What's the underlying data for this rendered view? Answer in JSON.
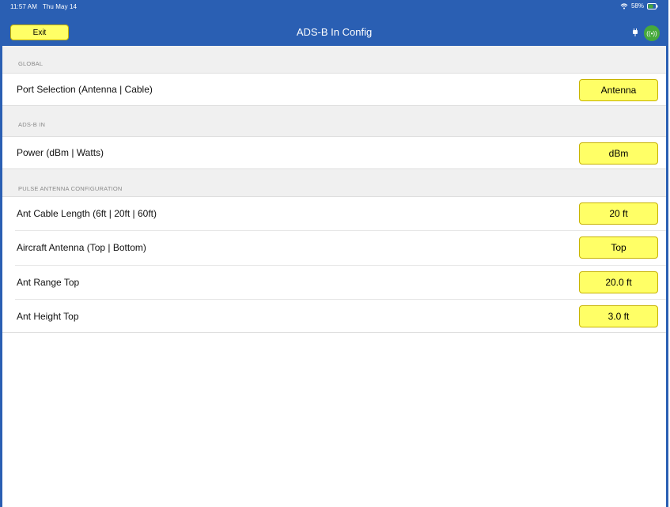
{
  "statusbar": {
    "time": "11:57 AM",
    "date": "Thu May 14",
    "battery": "58%"
  },
  "header": {
    "title": "ADS-B In Config",
    "exit_label": "Exit",
    "broadcast_symbol": "((•))"
  },
  "sections": {
    "global": {
      "title": "GLOBAL",
      "rows": [
        {
          "label": "Port Selection (Antenna | Cable)",
          "value": "Antenna"
        }
      ]
    },
    "adsb_in": {
      "title": "ADS-B IN",
      "rows": [
        {
          "label": "Power (dBm | Watts)",
          "value": "dBm"
        }
      ]
    },
    "pulse": {
      "title": "PULSE ANTENNA CONFIGURATION",
      "rows": [
        {
          "label": "Ant Cable Length (6ft | 20ft | 60ft)",
          "value": "20 ft"
        },
        {
          "label": "Aircraft Antenna (Top | Bottom)",
          "value": "Top"
        },
        {
          "label": "Ant Range Top",
          "value": "20.0 ft"
        },
        {
          "label": "Ant Height Top",
          "value": "3.0 ft"
        }
      ]
    }
  },
  "colors": {
    "header_blue": "#2a5fb3",
    "button_yellow": "#ffff66",
    "badge_green": "#46a93c",
    "section_bg": "#f0f0f0"
  }
}
